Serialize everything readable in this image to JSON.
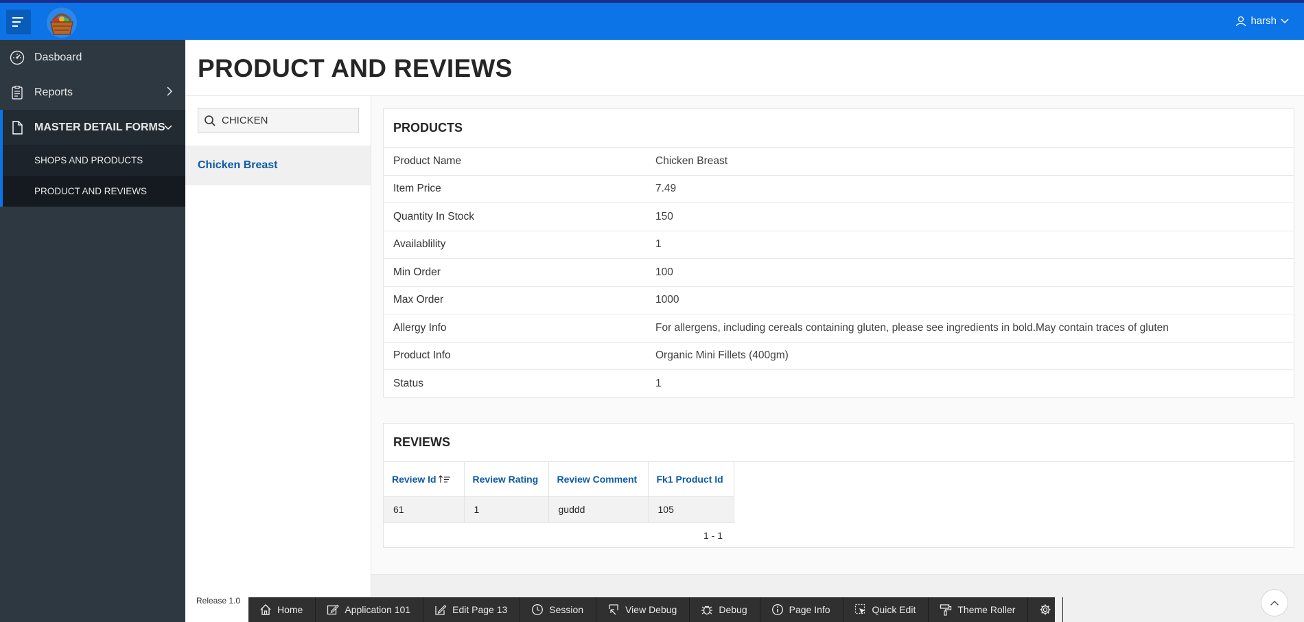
{
  "header": {
    "user_name": "harsh",
    "logo": "basket-logo",
    "accent_color": "#0d74e7"
  },
  "sidebar": {
    "items": [
      {
        "label": "Dasboard",
        "icon": "gauge-icon"
      },
      {
        "label": "Reports",
        "icon": "clipboard-icon"
      },
      {
        "label": "MASTER DETAIL FORMS",
        "icon": "document-icon"
      }
    ],
    "sub_items": [
      {
        "label": "SHOPS AND PRODUCTS"
      },
      {
        "label": "PRODUCT AND REVIEWS"
      }
    ]
  },
  "page": {
    "title": "PRODUCT AND REVIEWS"
  },
  "search": {
    "value": "CHICKEN"
  },
  "results": [
    {
      "label": "Chicken Breast"
    }
  ],
  "products": {
    "title": "PRODUCTS",
    "rows": [
      {
        "label": "Product Name",
        "value": "Chicken Breast"
      },
      {
        "label": "Item Price",
        "value": "7.49"
      },
      {
        "label": "Quantity In Stock",
        "value": "150"
      },
      {
        "label": "Availablility",
        "value": "1"
      },
      {
        "label": "Min Order",
        "value": "100"
      },
      {
        "label": "Max Order",
        "value": "1000"
      },
      {
        "label": "Allergy Info",
        "value": "For allergens, including cereals containing gluten, please see ingredients in bold.May contain traces of gluten"
      },
      {
        "label": "Product Info",
        "value": "Organic Mini Fillets (400gm)"
      },
      {
        "label": "Status",
        "value": "1"
      }
    ]
  },
  "reviews": {
    "title": "REVIEWS",
    "columns": [
      "Review Id",
      "Review Rating",
      "Review Comment",
      "Fk1 Product Id"
    ],
    "rows": [
      [
        "61",
        "1",
        "guddd",
        "105"
      ]
    ],
    "pagination": "1 - 1"
  },
  "footer": {
    "release": "Release 1.0"
  },
  "devbar": {
    "buttons": [
      {
        "label": "Home",
        "icon": "home-icon"
      },
      {
        "label": "Application 101",
        "icon": "edit-app-icon"
      },
      {
        "label": "Edit Page 13",
        "icon": "edit-page-icon"
      },
      {
        "label": "Session",
        "icon": "clock-icon"
      },
      {
        "label": "View Debug",
        "icon": "view-debug-icon"
      },
      {
        "label": "Debug",
        "icon": "bug-icon"
      },
      {
        "label": "Page Info",
        "icon": "info-icon"
      },
      {
        "label": "Quick Edit",
        "icon": "quick-edit-icon"
      },
      {
        "label": "Theme Roller",
        "icon": "paint-roller-icon"
      },
      {
        "label": "",
        "icon": "gear-icon"
      }
    ]
  }
}
